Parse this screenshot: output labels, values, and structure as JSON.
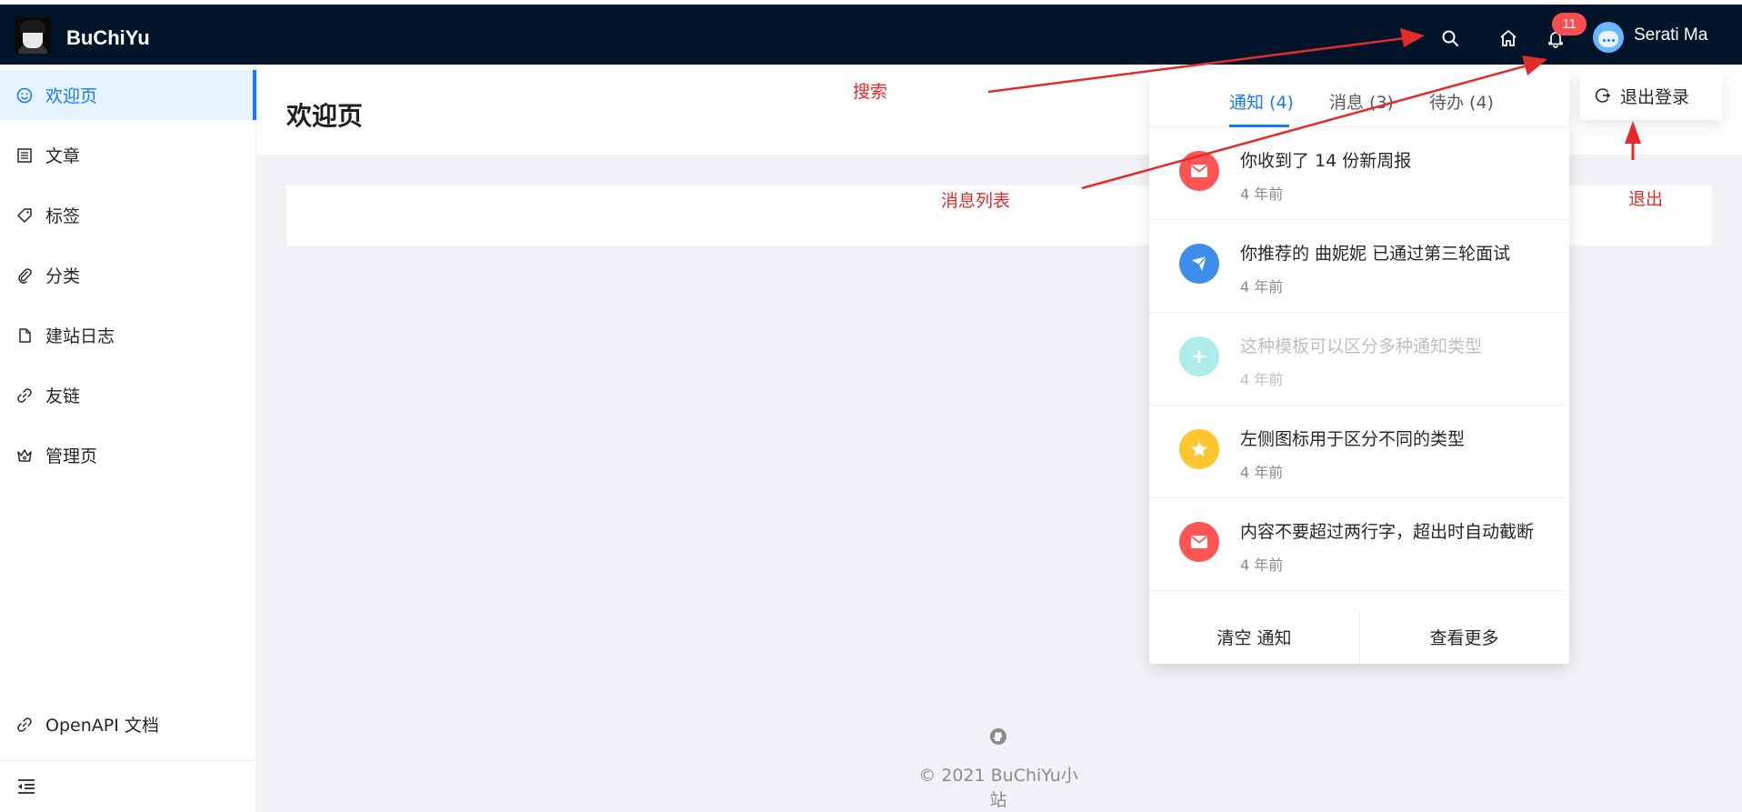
{
  "brand": {
    "name": "BuChiYu"
  },
  "header": {
    "badge_count": "11",
    "username": "Serati Ma",
    "icons": [
      "search-icon",
      "home-icon",
      "bell-icon"
    ]
  },
  "sidebar": {
    "items": [
      {
        "label": "欢迎页",
        "icon": "smile-icon",
        "active": true
      },
      {
        "label": "文章",
        "icon": "list-icon"
      },
      {
        "label": "标签",
        "icon": "tag-icon"
      },
      {
        "label": "分类",
        "icon": "paperclip-icon"
      },
      {
        "label": "建站日志",
        "icon": "file-icon"
      },
      {
        "label": "友链",
        "icon": "link-icon"
      },
      {
        "label": "管理页",
        "icon": "crown-icon"
      }
    ],
    "bottom_item": {
      "label": "OpenAPI 文档",
      "icon": "link-icon"
    }
  },
  "page": {
    "title": "欢迎页"
  },
  "footer": {
    "copyright": "© 2021 BuChiYu小站"
  },
  "notices": {
    "tabs": [
      {
        "label": "通知 (4)",
        "active": true
      },
      {
        "label": "消息 (3)"
      },
      {
        "label": "待办 (4)"
      }
    ],
    "items": [
      {
        "title": "你收到了 14 份新周报",
        "time": "4 年前",
        "icon": "mail-icon",
        "color": "#ff5454"
      },
      {
        "title": "你推荐的 曲妮妮 已通过第三轮面试",
        "time": "4 年前",
        "icon": "send-icon",
        "color": "#3c8ee8"
      },
      {
        "title": "这种模板可以区分多种通知类型",
        "time": "4 年前",
        "icon": "plus-icon",
        "color": "#4dd6d6",
        "read": true
      },
      {
        "title": "左侧图标用于区分不同的类型",
        "time": "4 年前",
        "icon": "star-icon",
        "color": "#fec52e"
      },
      {
        "title": "内容不要超过两行字，超出时自动截断",
        "time": "4 年前",
        "icon": "mail-icon",
        "color": "#ff5454"
      }
    ],
    "clear_label": "清空 通知",
    "more_label": "查看更多"
  },
  "logout": {
    "label": "退出登录"
  },
  "annotations": {
    "search": "搜索",
    "message_list": "消息列表",
    "logout": "退出",
    "color": "#e32b2b"
  },
  "colors": {
    "header_bg": "#001529",
    "primary": "#1677ff",
    "badge": "#ff4d4f",
    "content_bg": "#f0f2f5"
  }
}
